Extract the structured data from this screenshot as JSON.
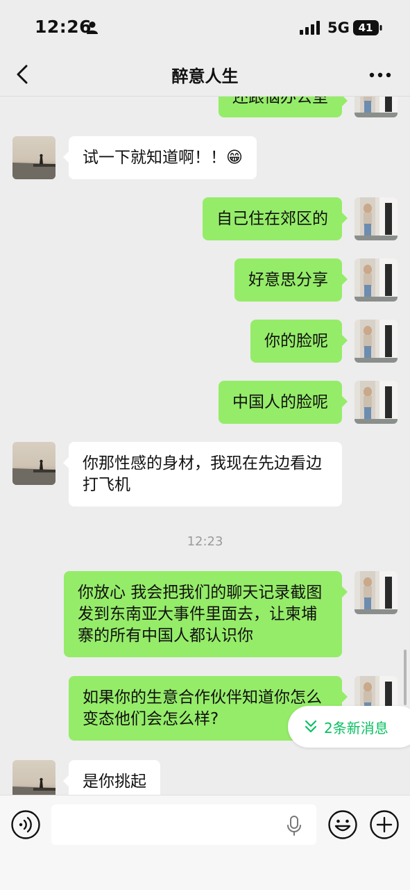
{
  "status_bar": {
    "time": "12:26",
    "network": "5G",
    "battery": "41"
  },
  "header": {
    "title": "醉意人生"
  },
  "messages": [
    {
      "side": "out",
      "text": "还跟恼办公室"
    },
    {
      "side": "in",
      "text": "试一下就知道啊！！😁"
    },
    {
      "side": "out",
      "text": "自己住在郊区的"
    },
    {
      "side": "out",
      "text": "好意思分享"
    },
    {
      "side": "out",
      "text": "你的脸呢"
    },
    {
      "side": "out",
      "text": "中国人的脸呢"
    },
    {
      "side": "in",
      "text": "你那性感的身材，我现在先边看边打飞机"
    },
    {
      "side": "time",
      "text": "12:23"
    },
    {
      "side": "out",
      "text": "你放心 我会把我们的聊天记录截图 发到东南亚大事件里面去，让柬埔寨的所有中国人都认识你"
    },
    {
      "side": "out",
      "text": "如果你的生意合作伙伴知道你怎么变态他们会怎么样?"
    },
    {
      "side": "in",
      "text": "是你挑起"
    }
  ],
  "new_messages": {
    "label": "2条新消息"
  },
  "input": {
    "value": "",
    "placeholder": ""
  },
  "colors": {
    "outgoing_bubble": "#95ec69",
    "incoming_bubble": "#ffffff",
    "background": "#ededed",
    "accent": "#07c160"
  },
  "icons": {
    "back": "chevron-left-icon",
    "more": "more-horizontal-icon",
    "voice": "voice-icon",
    "mic": "microphone-icon",
    "emoji": "emoji-icon",
    "plus": "plus-circle-icon",
    "new_messages": "double-chevron-down-icon"
  }
}
